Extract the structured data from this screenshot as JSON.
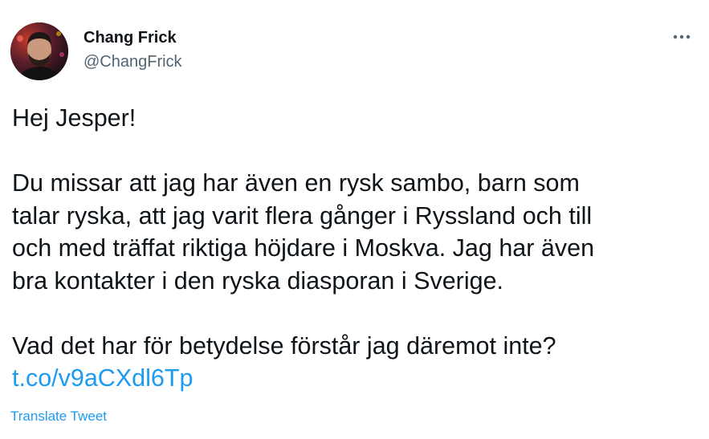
{
  "author": {
    "name": "Chang Frick",
    "handle": "@ChangFrick"
  },
  "icons": {
    "more": "more-horizontal-icon"
  },
  "tweet": {
    "greeting": "Hej Jesper!",
    "paragraph1": "Du missar att jag har även en rysk sambo, barn som\ntalar ryska, att jag varit flera gånger i Ryssland och till\noch med träffat riktiga höjdare i Moskva. Jag har även\nbra kontakter i den ryska diasporan i Sverige.",
    "paragraph2": "Vad det har för betydelse förstår jag däremot inte?",
    "link": "t.co/v9aCXdl6Tp"
  },
  "actions": {
    "translate_label": "Translate Tweet"
  },
  "colors": {
    "text": "#0f1419",
    "secondary": "#536471",
    "accent": "#1d9bf0"
  }
}
